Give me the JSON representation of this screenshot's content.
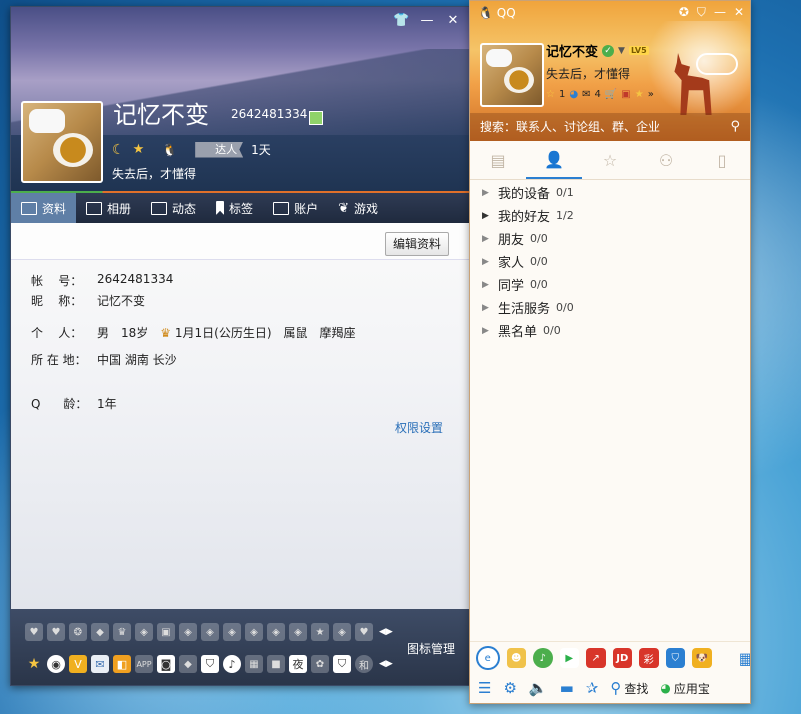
{
  "profile": {
    "nickname": "记忆不变",
    "qq_number": "2642481334",
    "daren_label": "达人",
    "daren_days": "1天",
    "signature": "失去后，才懂得",
    "tabs": [
      {
        "label": "资料",
        "icon": "profile-card-icon"
      },
      {
        "label": "相册",
        "icon": "album-icon"
      },
      {
        "label": "动态",
        "icon": "feed-icon"
      },
      {
        "label": "标签",
        "icon": "bookmark-icon"
      },
      {
        "label": "账户",
        "icon": "wallet-icon"
      },
      {
        "label": "游戏",
        "icon": "game-icon"
      }
    ],
    "edit_button": "编辑资料",
    "fields": {
      "account_key": "帐    号：",
      "account_val": "2642481334",
      "nick_key": "昵    称：",
      "nick_val": "记忆不变",
      "personal_key": "个    人：",
      "gender": "男",
      "age": "18岁",
      "birthday": "1月1日(公历生日)",
      "zodiac_animal": "属鼠",
      "star_sign": "摩羯座",
      "location_key": "所 在 地：",
      "location_val": "中国 湖南 长沙",
      "qage_key": "Q      龄：",
      "qage_val": "1年"
    },
    "permission_link": "权限设置",
    "icon_manage": "图标管理",
    "tray_icons_row2": {
      "app_label": "APP",
      "night_label": "夜",
      "circle_label": "和"
    }
  },
  "qq": {
    "title_logo": "QQ",
    "nickname": "记忆不变",
    "level_badge": "LV5",
    "signature": "失去后，才懂得",
    "status_counts": {
      "a": "1",
      "b": "4"
    },
    "search_placeholder": "搜索：联系人、讨论组、群、企业",
    "groups": [
      {
        "label": "我的设备",
        "count": "0/1"
      },
      {
        "label": "我的好友",
        "count": "1/2"
      },
      {
        "label": "朋友",
        "count": "0/0"
      },
      {
        "label": "家人",
        "count": "0/0"
      },
      {
        "label": "同学",
        "count": "0/0"
      },
      {
        "label": "生活服务",
        "count": "0/0"
      },
      {
        "label": "黑名单",
        "count": "0/0"
      }
    ],
    "apps": {
      "jd": "JD"
    },
    "bottom": {
      "find": "查找",
      "app_store": "应用宝"
    }
  },
  "colors": {
    "accent_blue": "#2b7fd1",
    "header_orange": "#f0a43c",
    "tab_active": "#5f7fa6"
  }
}
